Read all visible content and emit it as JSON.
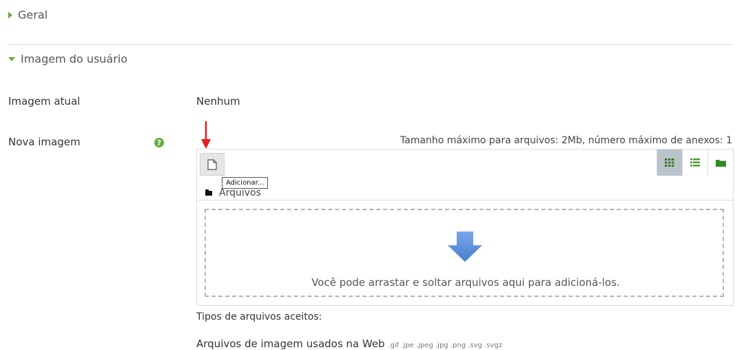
{
  "sections": {
    "geral": "Geral",
    "imagem_usuario": "Imagem do usuário"
  },
  "form": {
    "current_image_label": "Imagem atual",
    "current_image_value": "Nenhum",
    "new_image_label": "Nova imagem",
    "help_icon": "?"
  },
  "filepicker": {
    "max_size_text": "Tamanho máximo para arquivos: 2Mb, número máximo de anexos: 1",
    "add_tooltip": "Adicionar...",
    "path_label": "Arquivos",
    "dropzone_text": "Você pode arrastar e soltar arquivos aqui para adicioná-los.",
    "views": [
      "grid-view-icon",
      "list-view-icon",
      "folder-view-icon"
    ],
    "active_view": "grid-view-icon"
  },
  "accepted": {
    "title": "Tipos de arquivos aceitos:",
    "item_label": "Arquivos de imagem usados na Web",
    "item_extensions": ".gif .jpe .jpeg .jpg .png .svg .svgz"
  },
  "colors": {
    "accent_green": "#6aaa3c",
    "arrow_blue": "#5b8fd6",
    "annotation_red": "#e31c1c"
  }
}
